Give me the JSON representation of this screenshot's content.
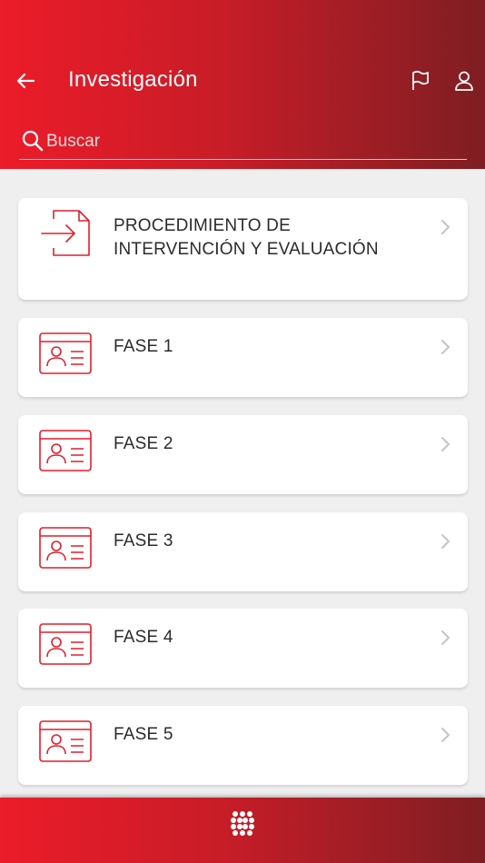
{
  "header": {
    "title": "Investigación",
    "back_icon": "arrow-left-icon",
    "flag_icon": "flag-icon",
    "user_icon": "user-icon",
    "gradient": [
      "#ec1c29",
      "#7e1e22"
    ]
  },
  "search": {
    "placeholder": "Buscar",
    "value": "",
    "icon": "search-icon"
  },
  "items": [
    {
      "label": "PROCEDIMIENTO DE INTERVENCIÓN Y EVALUACIÓN",
      "icon": "document-import-icon"
    },
    {
      "label": "FASE 1",
      "icon": "id-card-icon"
    },
    {
      "label": "FASE 2",
      "icon": "id-card-icon"
    },
    {
      "label": "FASE 3",
      "icon": "id-card-icon"
    },
    {
      "label": "FASE 4",
      "icon": "id-card-icon"
    },
    {
      "label": "FASE 5",
      "icon": "id-card-icon"
    }
  ],
  "bottom_bar": {
    "icon": "apps-grid-icon"
  },
  "colors": {
    "accent": "#e01f2b",
    "background": "#efefef",
    "card": "#ffffff"
  }
}
